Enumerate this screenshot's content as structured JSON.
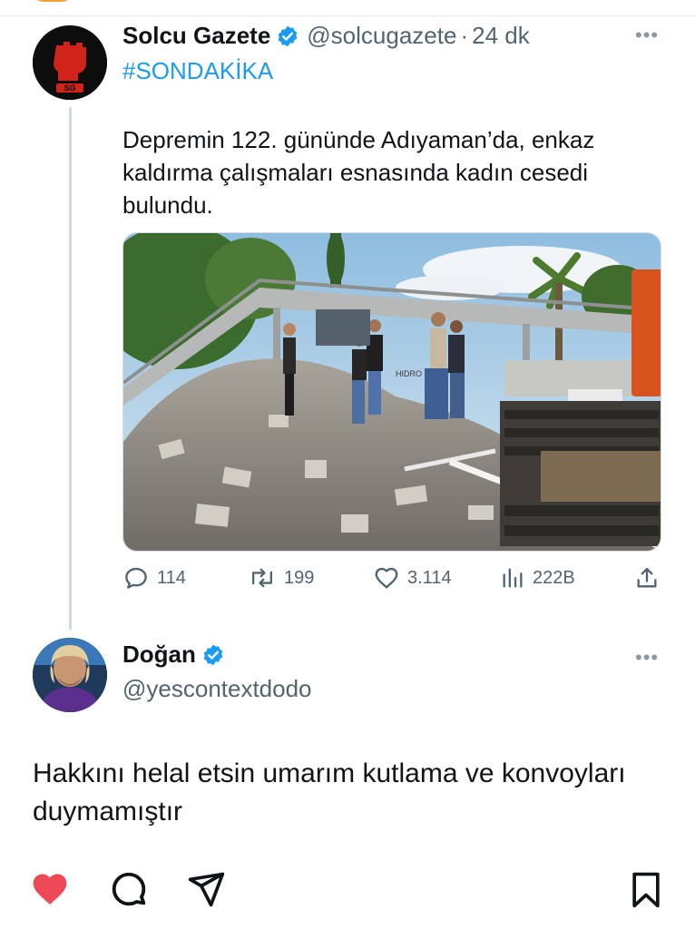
{
  "tweet": {
    "author_name": "Solcu Gazete",
    "handle": "@solcugazete",
    "separator": "·",
    "time": "24 dk",
    "hashtag": "#SONDAKİKA",
    "text": "Depremin 122. gününde Adıyaman’da, enkaz kaldırma çalışmaları esnasında kadın cesedi bulundu.",
    "avatar_logo_text": "SG",
    "image_signage_text": "HIDRO",
    "stats": {
      "replies": "114",
      "retweets": "199",
      "likes": "3.114",
      "views": "222B"
    }
  },
  "reply": {
    "author_name": "Doğan",
    "handle": "@yescontextdodo",
    "text": "Hakkını helal etsin umarım kutlama ve konvoyları duymamıştır"
  },
  "icons": {
    "verified": "verified-badge-icon",
    "more": "more-dots-icon",
    "reply": "comment-icon",
    "retweet": "retweet-icon",
    "like": "heart-icon",
    "views": "views-bar-icon",
    "share": "share-icon",
    "bottom_like": "heart-filled-icon",
    "bottom_comment": "comment-bubble-icon",
    "bottom_send": "send-icon",
    "bottom_save": "bookmark-icon"
  },
  "colors": {
    "verified_blue": "#1d9bf0",
    "hashtag_blue": "#1d9bf0",
    "secondary_text": "#536471",
    "liked_red": "#ed4956"
  }
}
